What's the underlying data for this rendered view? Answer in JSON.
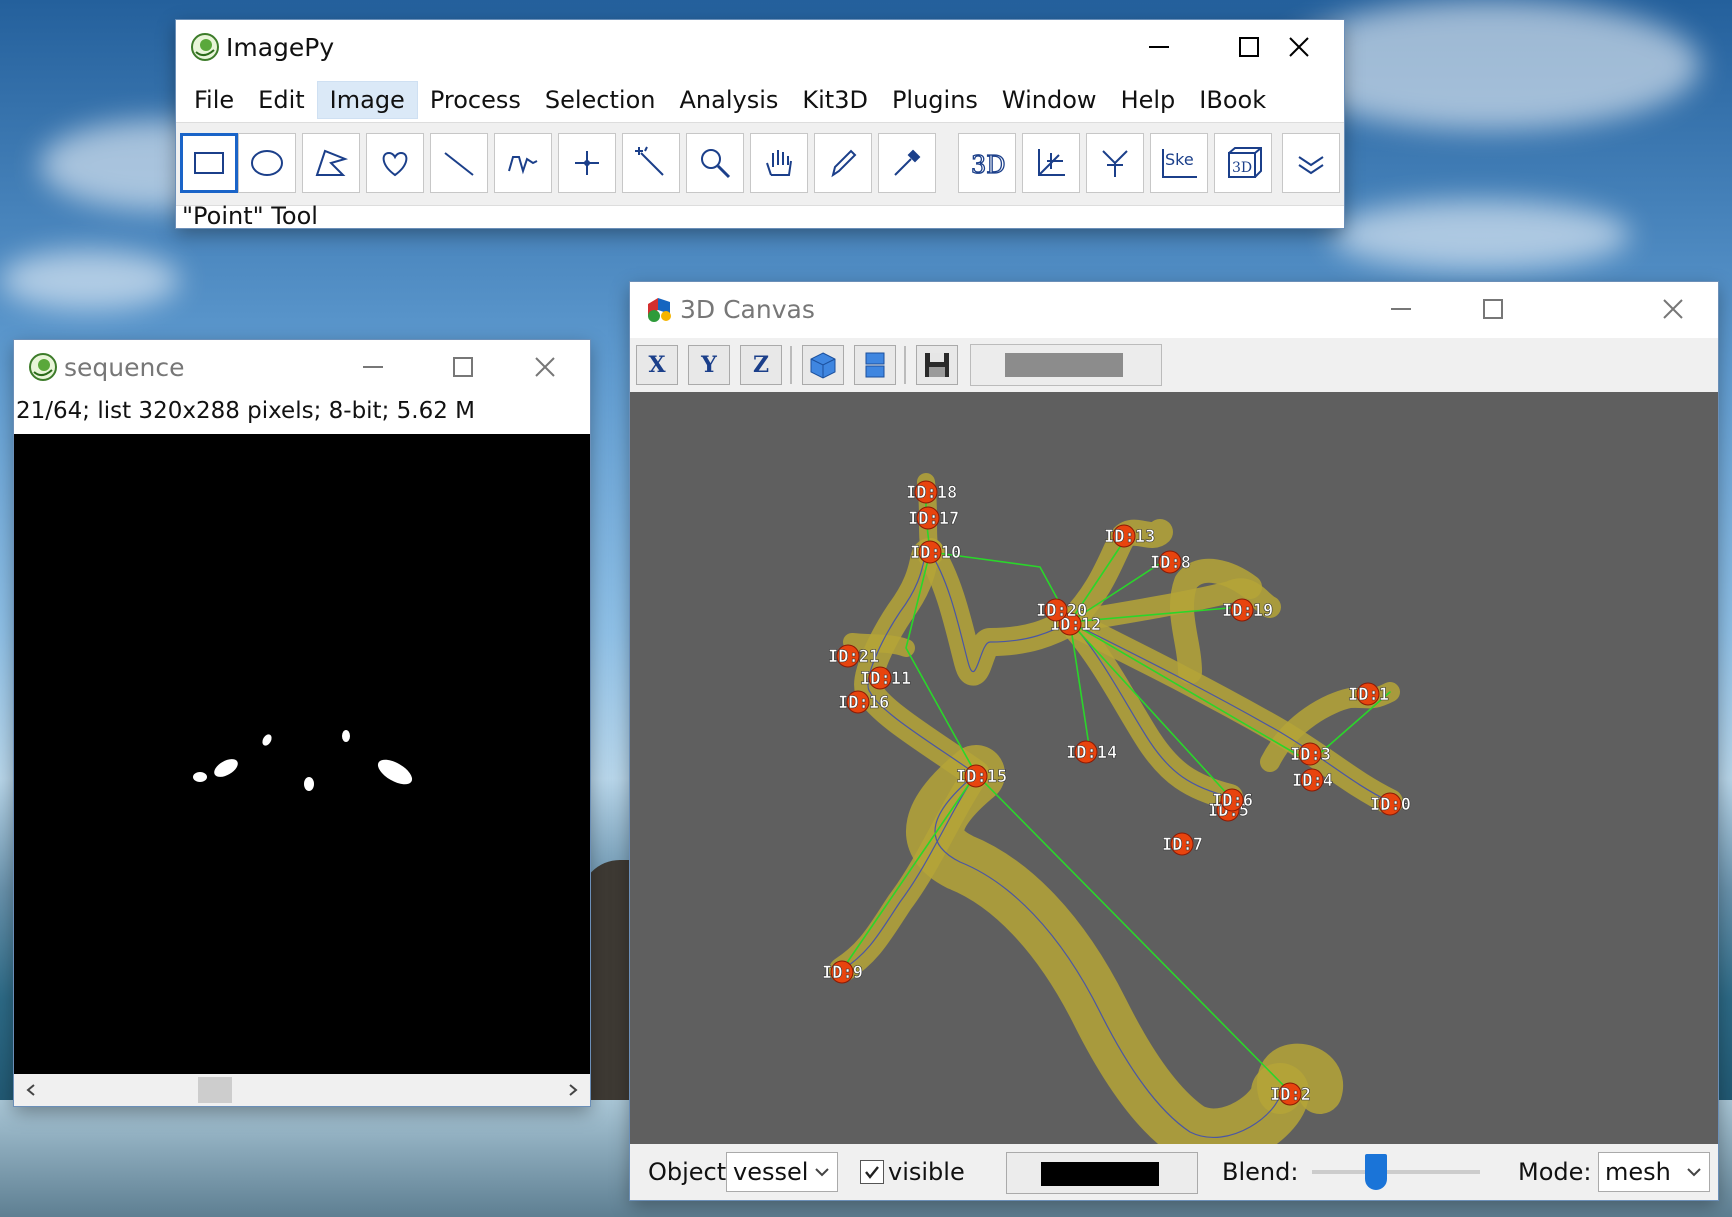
{
  "colors": {
    "accent": "#1a64c8",
    "vessel": "#b5a437",
    "skeleton_link": "#2ad62a",
    "node": "#e8440e",
    "canvas_background": "#5f5f5f"
  },
  "imagepy": {
    "title": "ImagePy",
    "icon": "imagepy-logo-icon",
    "menus": [
      "File",
      "Edit",
      "Image",
      "Process",
      "Selection",
      "Analysis",
      "Kit3D",
      "Plugins",
      "Window",
      "Help",
      "IBook"
    ],
    "active_menu": "Image",
    "tools": [
      {
        "name": "rectangle-tool-icon",
        "selected": true
      },
      {
        "name": "ellipse-tool-icon"
      },
      {
        "name": "polygon-tool-icon"
      },
      {
        "name": "freehand-tool-icon"
      },
      {
        "name": "line-tool-icon"
      },
      {
        "name": "polyline-tool-icon"
      },
      {
        "name": "point-tool-icon"
      },
      {
        "name": "magic-wand-tool-icon"
      },
      {
        "name": "zoom-tool-icon"
      },
      {
        "name": "hand-tool-icon"
      },
      {
        "name": "pencil-tool-icon"
      },
      {
        "name": "color-picker-tool-icon"
      },
      {
        "name": "3d-tool-icon",
        "label": "3D"
      },
      {
        "name": "axis-tool-icon"
      },
      {
        "name": "fork-tool-icon"
      },
      {
        "name": "skeleton-tool-icon",
        "label": "Ske"
      },
      {
        "name": "3d-box-tool-icon",
        "label": "3D"
      },
      {
        "name": "more-tools-icon"
      }
    ],
    "status": "\"Point\" Tool"
  },
  "sequence": {
    "title": "sequence",
    "info": "21/64; list  320x288 pixels; 8-bit; 5.62 M"
  },
  "canvas3d": {
    "title": "3D Canvas",
    "toolbar": [
      {
        "name": "x-view-button",
        "label": "X"
      },
      {
        "name": "y-view-button",
        "label": "Y"
      },
      {
        "name": "z-view-button",
        "label": "Z"
      },
      {
        "name": "perspective-cube-icon"
      },
      {
        "name": "orthographic-icon"
      },
      {
        "name": "save-icon"
      }
    ],
    "background_swatch": "#8c8c8c",
    "object_label": "Object:",
    "object_value": "vessel",
    "visible_label": "visible",
    "visible_checked": true,
    "object_color": "#000000",
    "blend_label": "Blend:",
    "blend_value": 0.38,
    "mode_label": "Mode:",
    "mode_value": "mesh",
    "nodes": [
      "ID:0",
      "ID:1",
      "ID:2",
      "ID:3",
      "ID:4",
      "ID:5",
      "ID:6",
      "ID:7",
      "ID:8",
      "ID:9",
      "ID:10",
      "ID:11",
      "ID:12",
      "ID:13",
      "ID:14",
      "ID:15",
      "ID:16",
      "ID:17",
      "ID:18",
      "ID:19",
      "ID:20",
      "ID:21"
    ]
  }
}
